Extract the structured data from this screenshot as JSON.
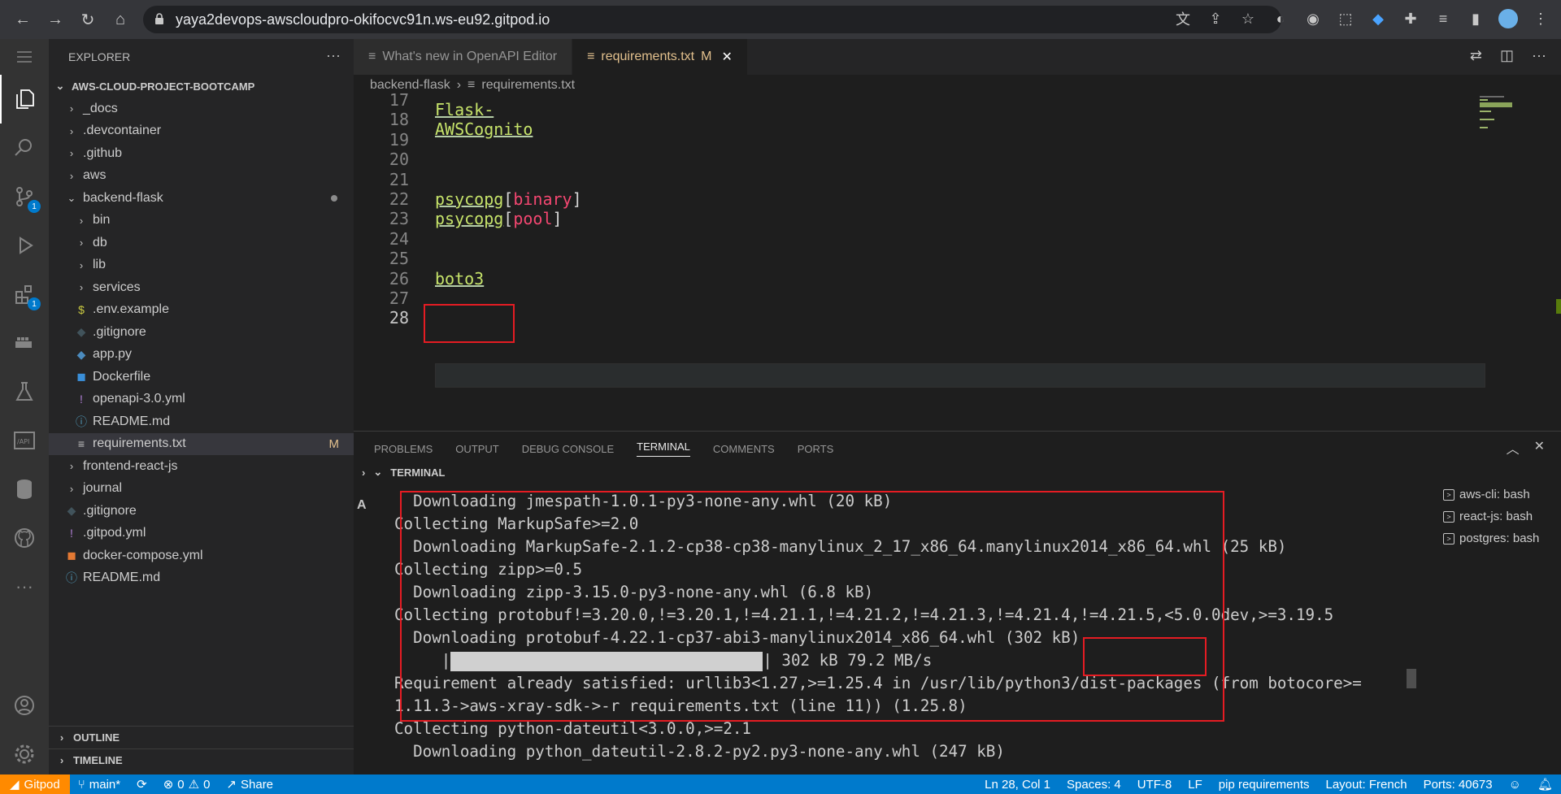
{
  "browser": {
    "url": "yaya2devops-awscloudpro-okifocvc91n.ws-eu92.gitpod.io"
  },
  "sidebar": {
    "title": "EXPLORER",
    "root": "AWS-CLOUD-PROJECT-BOOTCAMP",
    "items": [
      {
        "label": "_docs",
        "type": "folder",
        "depth": 1
      },
      {
        "label": ".devcontainer",
        "type": "folder",
        "depth": 1
      },
      {
        "label": ".github",
        "type": "folder",
        "depth": 1
      },
      {
        "label": "aws",
        "type": "folder",
        "depth": 1
      },
      {
        "label": "backend-flask",
        "type": "folder-open",
        "depth": 1
      },
      {
        "label": "bin",
        "type": "folder",
        "depth": 2
      },
      {
        "label": "db",
        "type": "folder",
        "depth": 2
      },
      {
        "label": "lib",
        "type": "folder",
        "depth": 2
      },
      {
        "label": "services",
        "type": "folder",
        "depth": 2
      },
      {
        "label": ".env.example",
        "type": "file",
        "depth": 2
      },
      {
        "label": ".gitignore",
        "type": "file",
        "depth": 2
      },
      {
        "label": "app.py",
        "type": "file",
        "depth": 2
      },
      {
        "label": "Dockerfile",
        "type": "file",
        "depth": 2
      },
      {
        "label": "openapi-3.0.yml",
        "type": "file",
        "depth": 2
      },
      {
        "label": "README.md",
        "type": "file",
        "depth": 2
      },
      {
        "label": "requirements.txt",
        "type": "file",
        "depth": 2,
        "modified": "M"
      },
      {
        "label": "frontend-react-js",
        "type": "folder",
        "depth": 1
      },
      {
        "label": "journal",
        "type": "folder",
        "depth": 1
      },
      {
        "label": ".gitignore",
        "type": "file",
        "depth": 1
      },
      {
        "label": ".gitpod.yml",
        "type": "file",
        "depth": 1
      },
      {
        "label": "docker-compose.yml",
        "type": "file",
        "depth": 1
      },
      {
        "label": "README.md",
        "type": "file",
        "depth": 1
      }
    ],
    "outline": "OUTLINE",
    "timeline": "TIMELINE"
  },
  "tabs": [
    {
      "label": "What's new in OpenAPI Editor",
      "active": false
    },
    {
      "label": "requirements.txt",
      "active": true,
      "modified": "M"
    }
  ],
  "breadcrumb": {
    "folder": "backend-flask",
    "file": "requirements.txt"
  },
  "editor": {
    "lines": [
      {
        "num": "17",
        "code": []
      },
      {
        "num": "18",
        "code": [
          {
            "t": "Flask-AWSCognito",
            "c": "pkg"
          }
        ]
      },
      {
        "num": "19",
        "code": []
      },
      {
        "num": "20",
        "code": []
      },
      {
        "num": "21",
        "code": []
      },
      {
        "num": "22",
        "code": [
          {
            "t": "psycopg",
            "c": "pkg"
          },
          {
            "t": "[",
            "c": "bracket"
          },
          {
            "t": "binary",
            "c": "extra"
          },
          {
            "t": "]",
            "c": "bracket"
          }
        ]
      },
      {
        "num": "23",
        "code": [
          {
            "t": "psycopg",
            "c": "pkg"
          },
          {
            "t": "[",
            "c": "bracket"
          },
          {
            "t": "pool",
            "c": "extra"
          },
          {
            "t": "]",
            "c": "bracket"
          }
        ]
      },
      {
        "num": "24",
        "code": []
      },
      {
        "num": "25",
        "code": []
      },
      {
        "num": "26",
        "code": [
          {
            "t": "boto3",
            "c": "pkg"
          }
        ]
      },
      {
        "num": "27",
        "code": []
      },
      {
        "num": "28",
        "code": []
      }
    ]
  },
  "panel": {
    "tabs": [
      "PROBLEMS",
      "OUTPUT",
      "DEBUG CONSOLE",
      "TERMINAL",
      "COMMENTS",
      "PORTS"
    ],
    "active_tab": "TERMINAL",
    "terminal_header": "TERMINAL",
    "terminal_lines": [
      "  Downloading jmespath-1.0.1-py3-none-any.whl (20 kB)",
      "Collecting MarkupSafe>=2.0",
      "  Downloading MarkupSafe-2.1.2-cp38-cp38-manylinux_2_17_x86_64.manylinux2014_x86_64.whl (25 kB)",
      "Collecting zipp>=0.5",
      "  Downloading zipp-3.15.0-py3-none-any.whl (6.8 kB)",
      "Collecting protobuf!=3.20.0,!=3.20.1,!=4.21.1,!=4.21.2,!=4.21.3,!=4.21.4,!=4.21.5,<5.0.0dev,>=3.19.5",
      "  Downloading protobuf-4.22.1-cp37-abi3-manylinux2014_x86_64.whl (302 kB)",
      "PROGRESS",
      "Requirement already satisfied: urllib3<1.27,>=1.25.4 in /usr/lib/python3/dist-packages (from botocore>=",
      "1.11.3->aws-xray-sdk->-r requirements.txt (line 11)) (1.25.8)",
      "Collecting python-dateutil<3.0.0,>=2.1",
      "  Downloading python_dateutil-2.8.2-py2.py3-none-any.whl (247 kB)"
    ],
    "progress_text": "302 kB 79.2 MB/s",
    "progress_fraction": 1.0,
    "terminals": [
      "aws-cli: bash",
      "react-js: bash",
      "postgres: bash"
    ]
  },
  "statusbar": {
    "gitpod": "Gitpod",
    "branch": "main*",
    "errors": "0",
    "warnings": "0",
    "share": "Share",
    "position": "Ln 28, Col 1",
    "spaces": "Spaces: 4",
    "encoding": "UTF-8",
    "eol": "LF",
    "language": "pip requirements",
    "layout": "Layout: French",
    "ports": "Ports: 40673"
  }
}
